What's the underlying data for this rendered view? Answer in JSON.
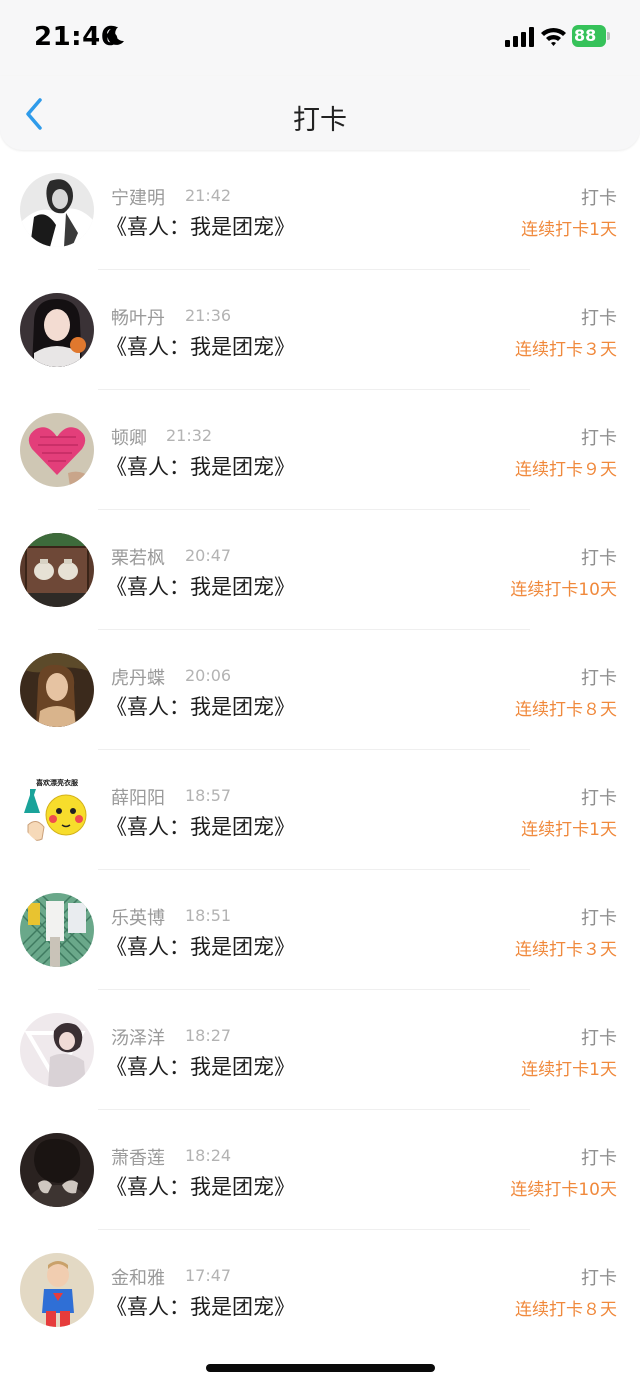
{
  "status_bar": {
    "time": "21:46",
    "battery": "88"
  },
  "nav": {
    "title": "打卡"
  },
  "rows": [
    {
      "name": "宁建明",
      "time": "21:42",
      "book": "《喜人：我是团宠》",
      "action": "打卡",
      "streak": "连续打卡1天",
      "avatar_icon": "person-photo-icon"
    },
    {
      "name": "畅叶丹",
      "time": "21:36",
      "book": "《喜人：我是团宠》",
      "action": "打卡",
      "streak": "连续打卡３天",
      "avatar_icon": "person-photo-icon"
    },
    {
      "name": "顿卿",
      "time": "21:32",
      "book": "《喜人：我是团宠》",
      "action": "打卡",
      "streak": "连续打卡９天",
      "avatar_icon": "heart-photo-icon"
    },
    {
      "name": "栗若枫",
      "time": "20:47",
      "book": "《喜人：我是团宠》",
      "action": "打卡",
      "streak": "连续打卡10天",
      "avatar_icon": "jars-photo-icon"
    },
    {
      "name": "虎丹蝶",
      "time": "20:06",
      "book": "《喜人：我是团宠》",
      "action": "打卡",
      "streak": "连续打卡８天",
      "avatar_icon": "person-photo-icon"
    },
    {
      "name": "薛阳阳",
      "time": "18:57",
      "book": "《喜人：我是团宠》",
      "action": "打卡",
      "streak": "连续打卡1天",
      "avatar_icon": "emoji-sticker-icon",
      "avatar_text": "喜欢漂亮衣服"
    },
    {
      "name": "乐英博",
      "time": "18:51",
      "book": "《喜人：我是团宠》",
      "action": "打卡",
      "streak": "连续打卡３天",
      "avatar_icon": "fence-photo-icon"
    },
    {
      "name": "汤泽洋",
      "time": "18:27",
      "book": "《喜人：我是团宠》",
      "action": "打卡",
      "streak": "连续打卡1天",
      "avatar_icon": "person-photo-icon"
    },
    {
      "name": "萧香莲",
      "time": "18:24",
      "book": "《喜人：我是团宠》",
      "action": "打卡",
      "streak": "连续打卡10天",
      "avatar_icon": "person-photo-icon"
    },
    {
      "name": "金和雅",
      "time": "17:47",
      "book": "《喜人：我是团宠》",
      "action": "打卡",
      "streak": "连续打卡８天",
      "avatar_icon": "child-photo-icon"
    }
  ],
  "colors": {
    "streak": "#f0893c",
    "accent": "#2f9bea",
    "battery": "#36c25a"
  }
}
